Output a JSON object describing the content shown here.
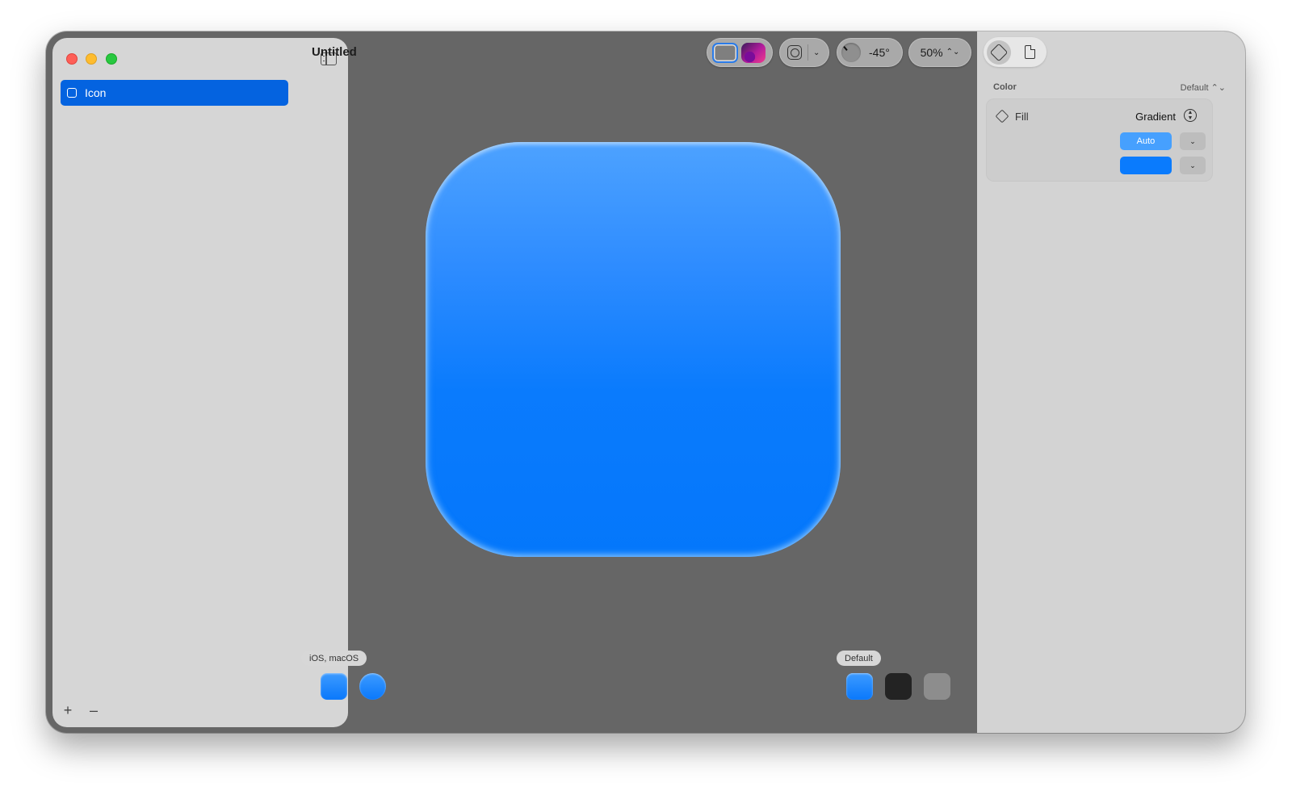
{
  "window": {
    "title": "Untitled"
  },
  "sidebar": {
    "layers": [
      {
        "label": "Icon",
        "selected": true
      }
    ],
    "add_label": "+",
    "remove_label": "–"
  },
  "toolbar": {
    "appearance_modes": [
      "light",
      "dark"
    ],
    "active_mode": "light",
    "grid_chevron": "⌄",
    "angle": "-45°",
    "zoom": "50%",
    "zoom_arrows": "⌃⌄"
  },
  "canvas": {
    "icon_gradient": {
      "top": "#4da2ff",
      "bottom": "#0477fb"
    },
    "platform_chip": "iOS, macOS",
    "platform_previews": [
      "rounded-square",
      "circle"
    ],
    "appearance_chip": "Default",
    "appearance_previews": [
      "default",
      "dark",
      "tinted"
    ]
  },
  "inspector": {
    "tabs": [
      {
        "name": "paint-bucket-icon",
        "active": true
      },
      {
        "name": "document-icon",
        "active": false
      }
    ],
    "section_title": "Color",
    "section_mode": "Default ⌃⌄",
    "fill": {
      "label": "Fill",
      "type": "Gradient",
      "stops": [
        {
          "label": "Auto",
          "color": "#46a0fe"
        },
        {
          "label": "",
          "color": "#0a7bfd"
        }
      ],
      "menu_chevron": "⌄"
    }
  },
  "colors": {
    "accent": "#0463e0",
    "canvas_bg": "#666666",
    "sidebar_bg": "#d6d6d6"
  }
}
